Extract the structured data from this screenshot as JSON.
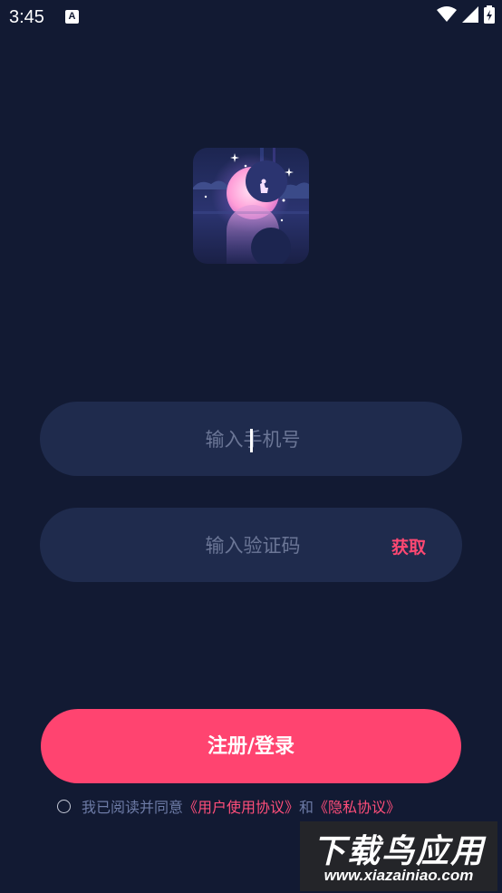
{
  "status_bar": {
    "time": "3:45",
    "notification_icon": "A",
    "icons": [
      "wifi-icon",
      "signal-icon",
      "battery-charging-icon"
    ]
  },
  "logo": {
    "icon": "moon-logo-icon"
  },
  "form": {
    "phone_placeholder": "输入手机号",
    "code_placeholder": "输入验证码",
    "get_code_label": "获取",
    "submit_label": "注册/登录"
  },
  "agreement": {
    "prefix": "我已阅读并同意",
    "user_agreement": "《用户使用协议》",
    "conjunction": "和",
    "privacy_policy": "《隐私协议》"
  },
  "watermark": {
    "title": "下载鸟应用",
    "url": "www.xiazainiao.com"
  },
  "colors": {
    "background": "#121a33",
    "input_bg": "#1f2b4d",
    "accent": "#ff4470",
    "muted_text": "#6d7ba6"
  }
}
